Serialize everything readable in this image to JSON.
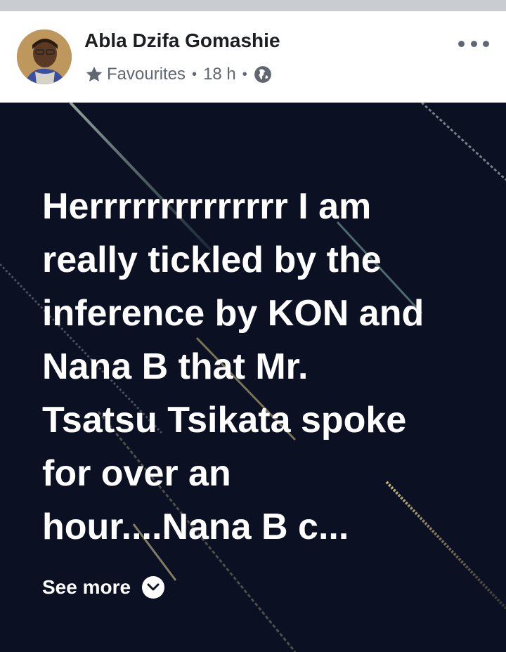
{
  "post": {
    "author": "Abla Dzifa Gomashie",
    "audience": "Favourites",
    "separator": "•",
    "time": "18 h",
    "icons": {
      "audience": "star-icon",
      "privacy": "globe-icon",
      "menu": "more-horizontal-icon",
      "expand": "chevron-down-icon"
    },
    "body_lines": [
      "Herrrrrrrrrrrrrr I am",
      "really tickled by the",
      "inference by KON and",
      "Nana B that Mr.",
      "Tsatsu Tsikata spoke",
      "for over an",
      "hour....Nana B c..."
    ],
    "see_more": "See more",
    "colors": {
      "background": "#0b1022",
      "text": "#ffffff",
      "meta": "#606770",
      "author": "#1c1e21"
    }
  }
}
